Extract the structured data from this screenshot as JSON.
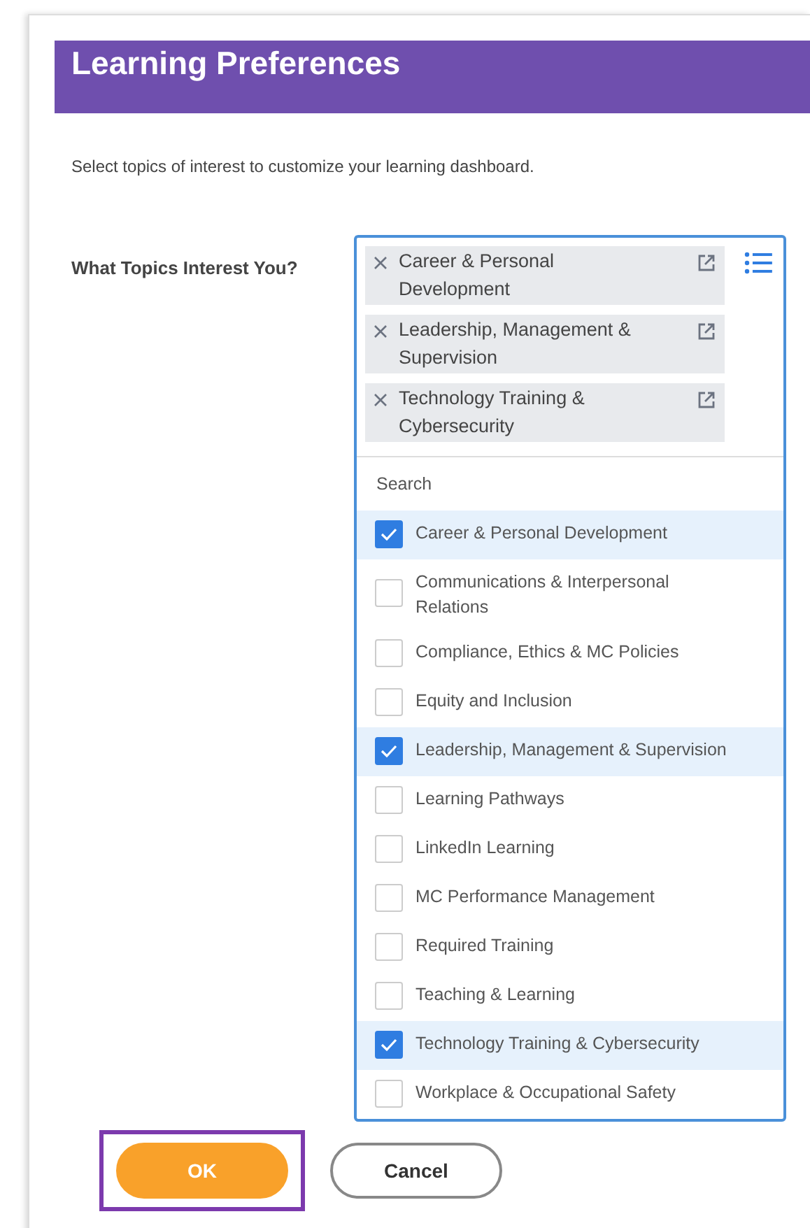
{
  "header": {
    "title": "Learning Preferences"
  },
  "description": "Select topics of interest to customize your learning dashboard.",
  "field": {
    "label": "What Topics Interest You?",
    "chips": [
      "Career & Personal Development",
      "Leadership, Management & Supervision",
      "Technology Training & Cybersecurity"
    ],
    "search": {
      "placeholder": "Search"
    },
    "options": [
      {
        "label": "Career & Personal Development",
        "checked": true
      },
      {
        "label": "Communications & Interpersonal Relations",
        "checked": false
      },
      {
        "label": "Compliance, Ethics & MC Policies",
        "checked": false
      },
      {
        "label": "Equity and Inclusion",
        "checked": false
      },
      {
        "label": "Leadership, Management & Supervision",
        "checked": true
      },
      {
        "label": "Learning Pathways",
        "checked": false
      },
      {
        "label": "LinkedIn Learning",
        "checked": false
      },
      {
        "label": "MC Performance Management",
        "checked": false
      },
      {
        "label": "Required Training",
        "checked": false
      },
      {
        "label": "Teaching & Learning",
        "checked": false
      },
      {
        "label": "Technology Training & Cybersecurity",
        "checked": true
      },
      {
        "label": "Workplace & Occupational Safety",
        "checked": false
      }
    ]
  },
  "buttons": [
    {
      "label": "OK",
      "kind": "primary",
      "highlighted": true
    },
    {
      "label": "Cancel",
      "kind": "secondary",
      "highlighted": false
    }
  ]
}
